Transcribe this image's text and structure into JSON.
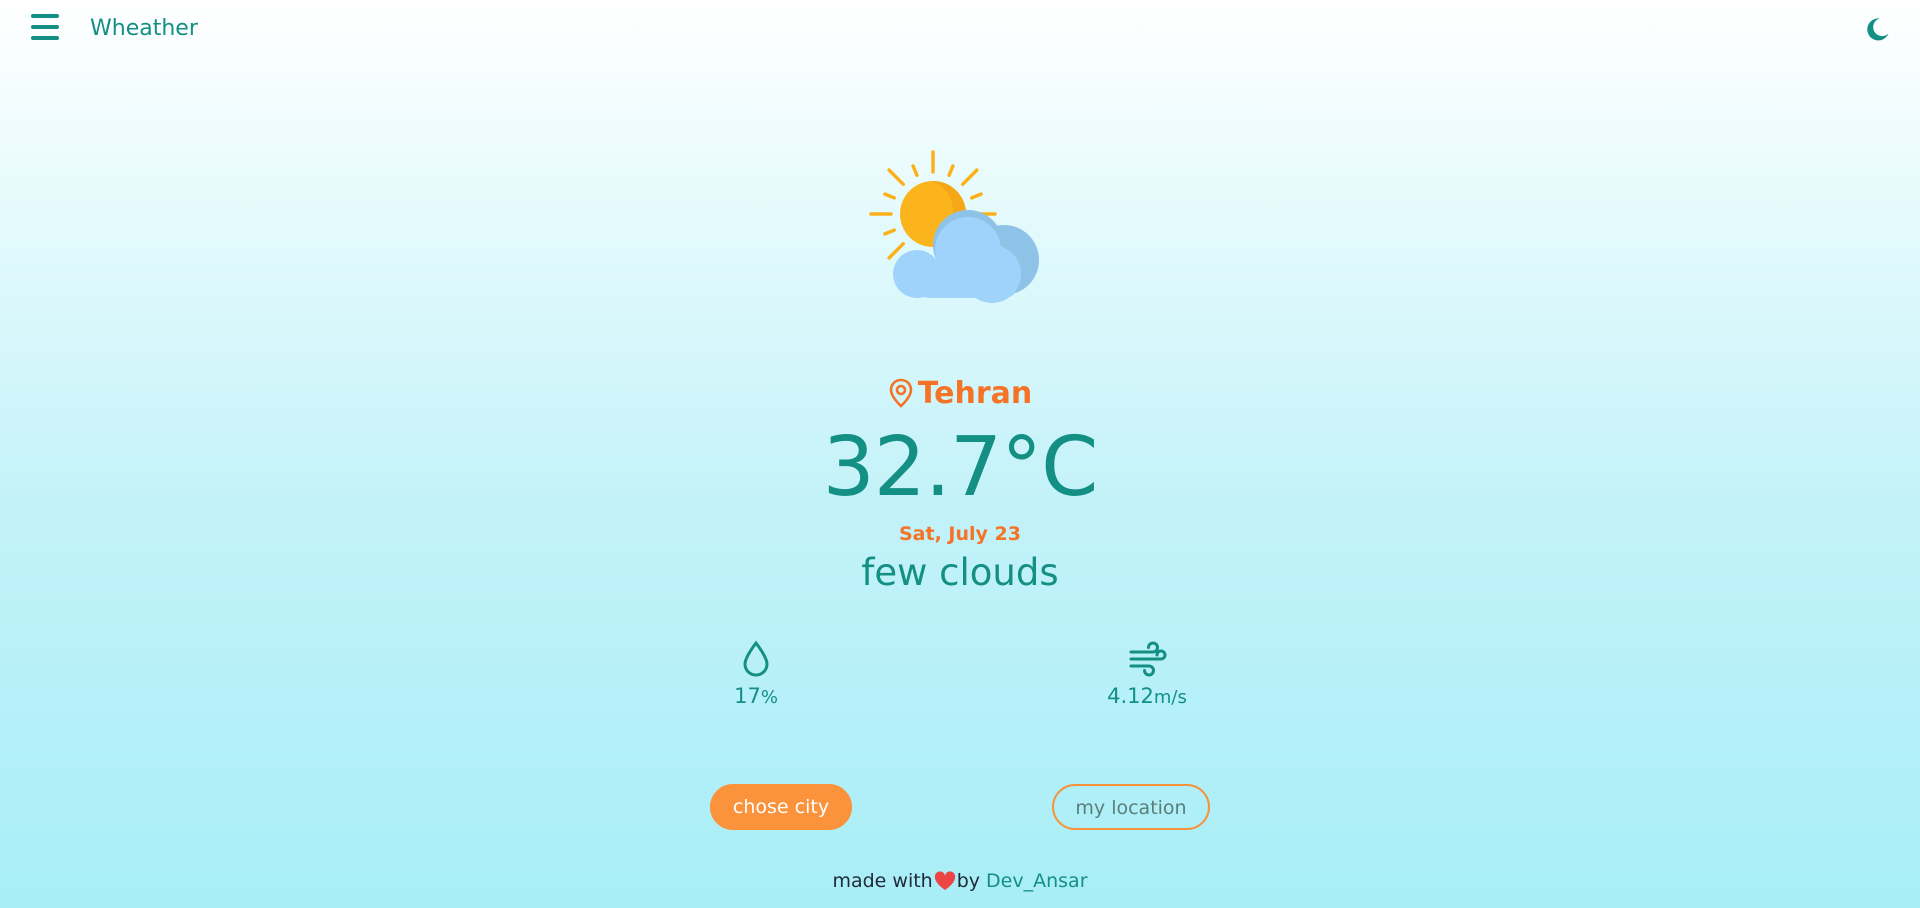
{
  "header": {
    "title": "Wheather",
    "menu_icon": "hamburger-icon",
    "theme_icon": "moon-icon"
  },
  "weather": {
    "icon": "partly-cloudy-icon",
    "city": "Tehran",
    "temperature": "32.7°C",
    "date": "Sat, July 23",
    "description": "few clouds",
    "humidity": {
      "icon": "droplet-icon",
      "value": "17",
      "unit": "%"
    },
    "wind": {
      "icon": "wind-icon",
      "value": "4.12",
      "unit": "m/s"
    }
  },
  "actions": {
    "chose_city": "chose city",
    "my_location": "my location"
  },
  "footer": {
    "made_with": "made with",
    "by": "by",
    "author": "Dev_Ansar"
  },
  "colors": {
    "primary": "#138f84",
    "accent": "#f47326",
    "button": "#fb923c",
    "heart": "#ef4444"
  }
}
